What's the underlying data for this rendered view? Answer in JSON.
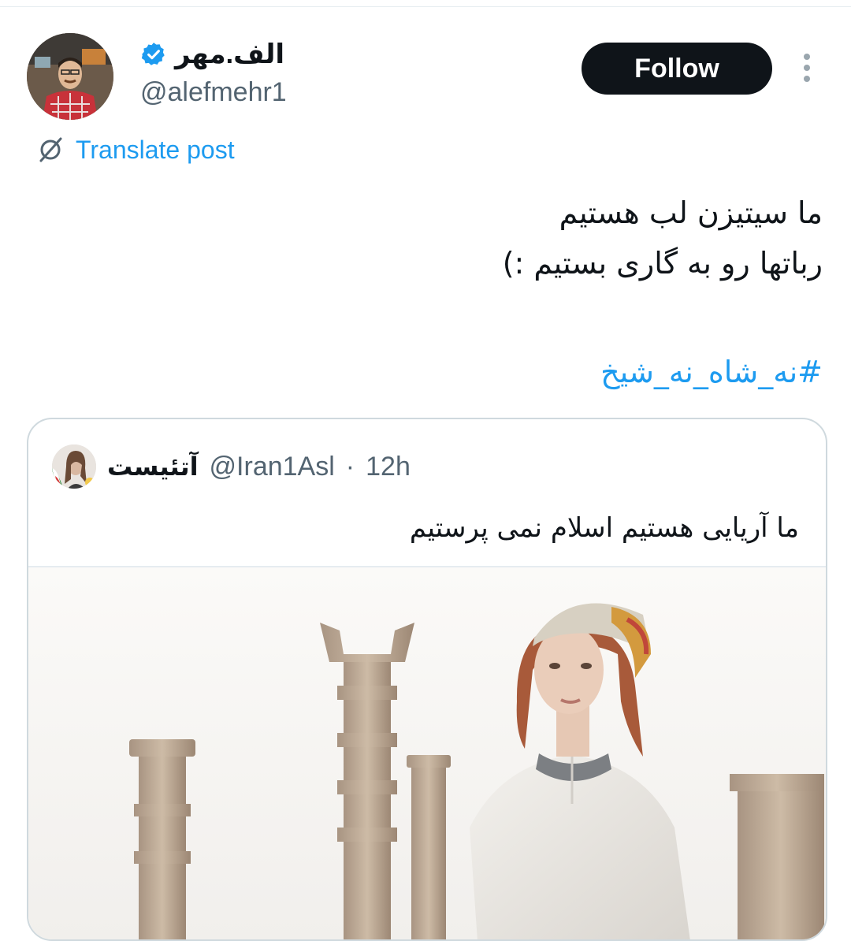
{
  "author": {
    "display_name": "الف.مهر",
    "handle": "@alefmehr1",
    "verified": true,
    "avatar_icon": "avatar-photo"
  },
  "actions": {
    "follow_label": "Follow",
    "more_icon": "more-vertical-icon"
  },
  "translate": {
    "label": "Translate post",
    "icon": "translate-icon"
  },
  "tweet": {
    "line1": "ما سیتیزن لب هستیم",
    "line2": "رباتها رو به گاری بستیم :)",
    "hashtag": "#نه_شاه_نه_شیخ"
  },
  "quoted": {
    "display_name": "آتئیست",
    "handle": "@Iran1Asl",
    "separator": "·",
    "time": "12h",
    "text": "ما آریایی هستیم اسلام نمی پرستیم",
    "image_icon": "quoted-photo"
  },
  "colors": {
    "accent": "#1d9bf0",
    "text": "#0f1419",
    "secondary": "#536471",
    "border": "#cfd9de",
    "button_bg": "#0f1419"
  }
}
